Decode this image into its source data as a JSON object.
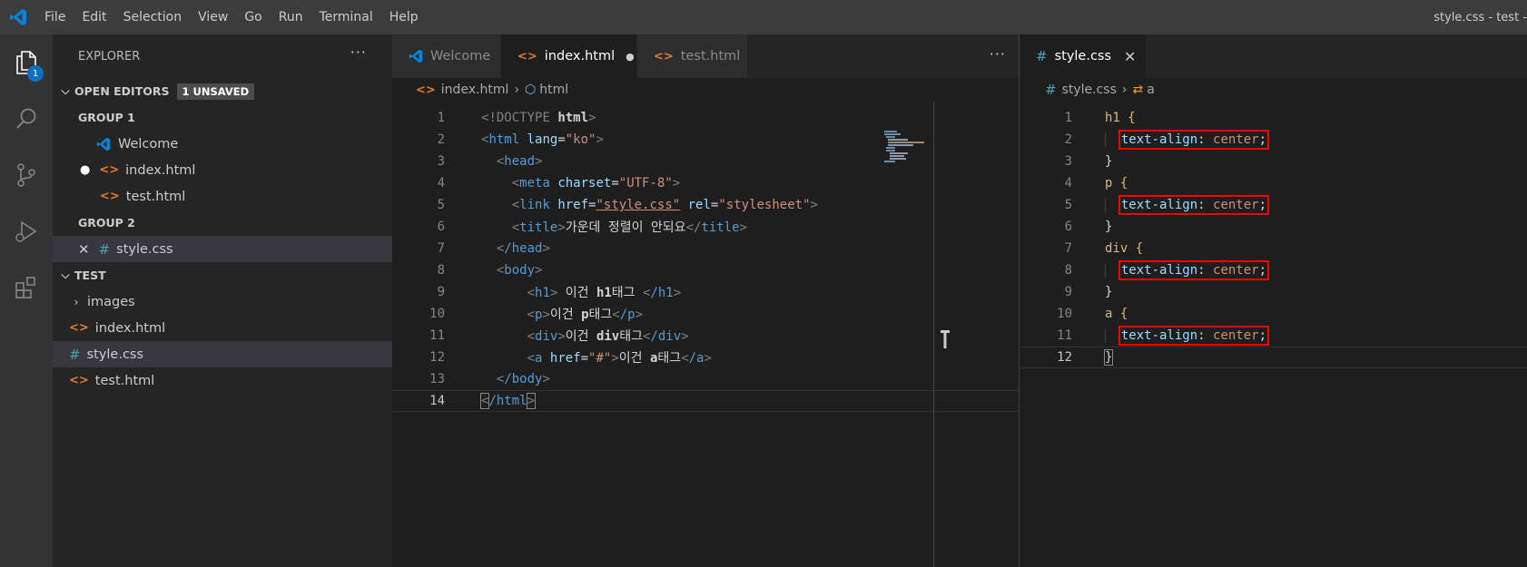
{
  "titlebar": {
    "menu": [
      "File",
      "Edit",
      "Selection",
      "View",
      "Go",
      "Run",
      "Terminal",
      "Help"
    ],
    "window_title": "style.css - test -"
  },
  "activitybar": {
    "items": [
      "explorer-icon",
      "search-icon",
      "source-control-icon",
      "run-debug-icon",
      "extensions-icon"
    ],
    "explorer_badge": "1"
  },
  "sidebar": {
    "title": "EXPLORER",
    "more": "···",
    "open_editors": {
      "label": "OPEN EDITORS",
      "badge": "1 UNSAVED",
      "groups": [
        {
          "label": "GROUP 1",
          "items": [
            "Welcome",
            "index.html",
            "test.html"
          ]
        },
        {
          "label": "GROUP 2",
          "items": [
            "style.css"
          ]
        }
      ]
    },
    "workspace": {
      "label": "TEST",
      "items": [
        "images",
        "index.html",
        "style.css",
        "test.html"
      ]
    }
  },
  "editor1": {
    "tabs": [
      {
        "label": "Welcome",
        "icon": "vscode-icon"
      },
      {
        "label": "index.html",
        "icon": "html-icon",
        "unsaved": true
      },
      {
        "label": "test.html",
        "icon": "html-icon"
      }
    ],
    "more": "···",
    "breadcrumb": [
      "index.html",
      "html"
    ],
    "current_line": "14",
    "lines": [
      {
        "n": "1"
      },
      {
        "n": "2"
      },
      {
        "n": "3"
      },
      {
        "n": "4"
      },
      {
        "n": "5"
      },
      {
        "n": "6"
      },
      {
        "n": "7"
      },
      {
        "n": "8"
      },
      {
        "n": "9"
      },
      {
        "n": "10"
      },
      {
        "n": "11"
      },
      {
        "n": "12"
      },
      {
        "n": "13"
      },
      {
        "n": "14"
      }
    ],
    "code": {
      "l1_doctype": "!DOCTYPE",
      "l1_html": "html",
      "l2_tag": "html",
      "l2_attr": "lang",
      "l2_val": "\"ko\"",
      "l3_tag": "head",
      "l4_tag": "meta",
      "l4_attr": "charset",
      "l4_val": "\"UTF-8\"",
      "l5_tag": "link",
      "l5_attr1": "href",
      "l5_val1": "\"style.css\"",
      "l5_attr2": "rel",
      "l5_val2": "\"stylesheet\"",
      "l6_tag": "title",
      "l6_text": "가운데 정렬이 안되요",
      "l7_tag": "/head",
      "l8_tag": "body",
      "l9_tag": "h1",
      "l9_text1": " 이건 ",
      "l9_text2": "h1",
      "l9_text3": "태그 ",
      "l9_close": "/h1",
      "l10_tag": "p",
      "l10_text1": "이건 ",
      "l10_text2": "p",
      "l10_text3": "태그",
      "l10_close": "/p",
      "l11_tag": "div",
      "l11_text1": "이건 ",
      "l11_text2": "div",
      "l11_text3": "태그",
      "l11_close": "/div",
      "l12_tag": "a",
      "l12_attr": "href",
      "l12_val": "\"#\"",
      "l12_text1": "이건 ",
      "l12_text2": "a",
      "l12_text3": "태그",
      "l12_close": "/a",
      "l13_tag": "/body",
      "l14_tag": "/html"
    }
  },
  "editor2": {
    "tab": {
      "label": "style.css",
      "icon": "css-icon",
      "close": "✕"
    },
    "breadcrumb": [
      "style.css",
      "a"
    ],
    "current_line": "12",
    "lines": [
      {
        "n": "1",
        "text": "h1 {"
      },
      {
        "n": "2",
        "prop": "text-align",
        "val": "center"
      },
      {
        "n": "3",
        "text": "}"
      },
      {
        "n": "4",
        "text": "p {"
      },
      {
        "n": "5",
        "prop": "text-align",
        "val": "center"
      },
      {
        "n": "6",
        "text": "}"
      },
      {
        "n": "7",
        "text": "div {"
      },
      {
        "n": "8",
        "prop": "text-align",
        "val": "center"
      },
      {
        "n": "9",
        "text": "}"
      },
      {
        "n": "10",
        "text": "a {"
      },
      {
        "n": "11",
        "prop": "text-align",
        "val": "center"
      },
      {
        "n": "12",
        "text": "}"
      }
    ],
    "highlight_color": "#ff0000"
  },
  "colors": {
    "titlebar": "#3c3c3c",
    "activitybar": "#333333",
    "sidebar": "#252526",
    "editor": "#1e1e1e",
    "accent": "#0e70c0"
  }
}
